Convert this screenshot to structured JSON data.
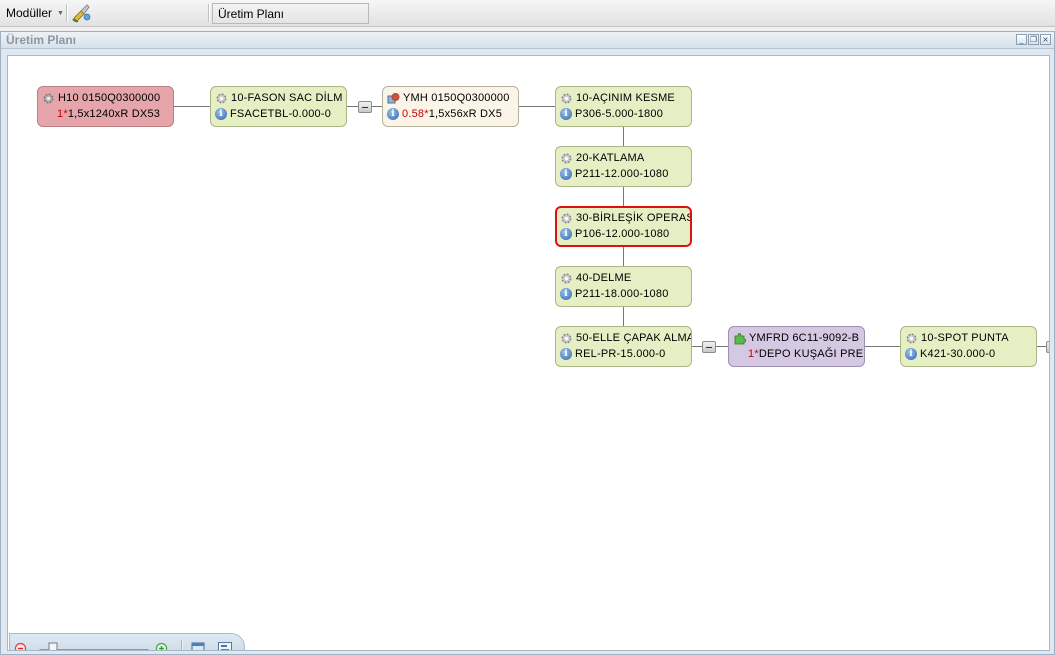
{
  "toolbar": {
    "modules_label": "Modüller",
    "tab_title": "Üretim Planı"
  },
  "panel": {
    "title": "Üretim Planı",
    "window_buttons": [
      "minimize",
      "restore",
      "close"
    ]
  },
  "nodes": {
    "h10": {
      "title": "H10 0150Q0300000",
      "qty": "1*",
      "detail": "1,5x1240xR DX53"
    },
    "fason": {
      "title": "10-FASON SAC DİLM",
      "detail": "FSACETBL-0.000-0"
    },
    "ymh": {
      "title": "YMH 0150Q0300000",
      "qty": "0.58*",
      "detail": "1,5x56xR DX5"
    },
    "acinim": {
      "title": "10-AÇINIM KESME",
      "detail": "P306-5.000-1800"
    },
    "katlama": {
      "title": "20-KATLAMA",
      "detail": "P211-12.000-1080"
    },
    "birlesik": {
      "title": "30-BİRLEŞİK OPERAS",
      "detail": "P106-12.000-1080"
    },
    "delme": {
      "title": "40-DELME",
      "detail": "P211-18.000-1080"
    },
    "capak": {
      "title": "50-ELLE ÇAPAK ALMA",
      "detail": "REL-PR-15.000-0"
    },
    "ymfrd": {
      "title": "YMFRD 6C11-9092-B",
      "qty": "1*",
      "detail": "DEPO KUŞAĞI PRE"
    },
    "spot": {
      "title": "10-SPOT PUNTA",
      "detail": "K421-30.000-0"
    }
  },
  "colors": {
    "operation_node": "#e5efc3",
    "product_node": "#e5a5aa",
    "semi_product_node": "#faf5e8",
    "assembly_node": "#d5c8e3",
    "selected_border": "#dd1111",
    "quantity_text": "#cc0000"
  },
  "zoom": {
    "level": 0.13
  },
  "icons": [
    "gear-icon",
    "info-icon",
    "puzzle-icon",
    "zoom-out-icon",
    "zoom-in-icon",
    "export-icon",
    "fit-icon"
  ]
}
